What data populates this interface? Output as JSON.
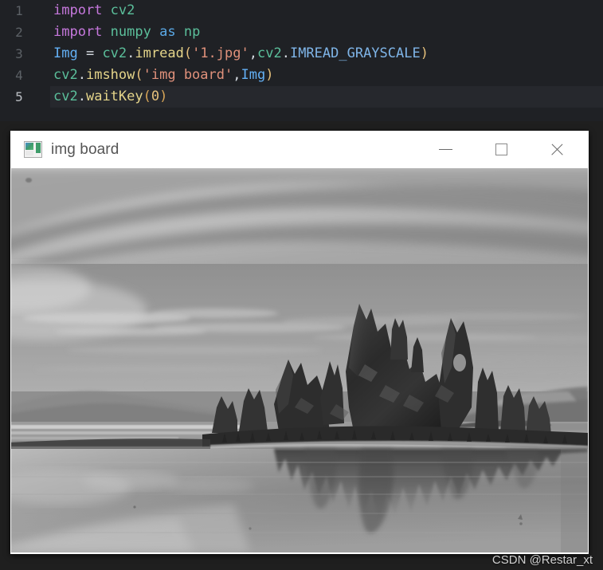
{
  "editor": {
    "name": "python-code-editor",
    "background": "#1f2125",
    "active_line": 5,
    "lines": [
      {
        "number": "1",
        "text": "import cv2",
        "tokens": [
          {
            "t": "import",
            "c": "tk-kw"
          },
          {
            "t": " ",
            "c": "tk-op"
          },
          {
            "t": "cv2",
            "c": "tk-mod"
          }
        ]
      },
      {
        "number": "2",
        "text": "import numpy as np",
        "tokens": [
          {
            "t": "import",
            "c": "tk-kw"
          },
          {
            "t": " ",
            "c": "tk-op"
          },
          {
            "t": "numpy",
            "c": "tk-mod"
          },
          {
            "t": " ",
            "c": "tk-op"
          },
          {
            "t": "as",
            "c": "tk-as"
          },
          {
            "t": " ",
            "c": "tk-op"
          },
          {
            "t": "np",
            "c": "tk-mod"
          }
        ]
      },
      {
        "number": "3",
        "text": "Img = cv2.imread('1.jpg',cv2.IMREAD_GRAYSCALE)",
        "tokens": [
          {
            "t": "Img",
            "c": "tk-var"
          },
          {
            "t": " = ",
            "c": "tk-op"
          },
          {
            "t": "cv2",
            "c": "tk-mod"
          },
          {
            "t": ".",
            "c": "tk-punct"
          },
          {
            "t": "imread",
            "c": "tk-fn"
          },
          {
            "t": "(",
            "c": "tk-paren"
          },
          {
            "t": "'1.jpg'",
            "c": "tk-str"
          },
          {
            "t": ",",
            "c": "tk-punct"
          },
          {
            "t": "cv2",
            "c": "tk-mod"
          },
          {
            "t": ".",
            "c": "tk-punct"
          },
          {
            "t": "IMREAD_GRAYSCALE",
            "c": "tk-const"
          },
          {
            "t": ")",
            "c": "tk-paren"
          }
        ]
      },
      {
        "number": "4",
        "text": "cv2.imshow('img board',Img)",
        "tokens": [
          {
            "t": "cv2",
            "c": "tk-mod"
          },
          {
            "t": ".",
            "c": "tk-punct"
          },
          {
            "t": "imshow",
            "c": "tk-fn"
          },
          {
            "t": "(",
            "c": "tk-paren"
          },
          {
            "t": "'img board'",
            "c": "tk-str"
          },
          {
            "t": ",",
            "c": "tk-punct"
          },
          {
            "t": "Img",
            "c": "tk-var"
          },
          {
            "t": ")",
            "c": "tk-paren"
          }
        ]
      },
      {
        "number": "5",
        "text": "cv2.waitKey(0)",
        "tokens": [
          {
            "t": "cv2",
            "c": "tk-mod"
          },
          {
            "t": ".",
            "c": "tk-punct"
          },
          {
            "t": "waitKey",
            "c": "tk-fn"
          },
          {
            "t": "(",
            "c": "tk-paren2"
          },
          {
            "t": "0",
            "c": "tk-num"
          },
          {
            "t": ")",
            "c": "tk-paren2"
          }
        ]
      }
    ]
  },
  "cv_window": {
    "title": "img board",
    "icon": "image-window-icon",
    "controls": {
      "minimize_label": "—",
      "maximize_label": "□",
      "close_label": "✕"
    },
    "image": {
      "name": "mono-lake-tufa-grayscale",
      "description": "Grayscale photograph of tufa rock towers on a still lake with reflections, layered clouds and distant mountains",
      "colorspace": "grayscale"
    }
  },
  "watermark": {
    "text": "CSDN @Restar_xt"
  }
}
